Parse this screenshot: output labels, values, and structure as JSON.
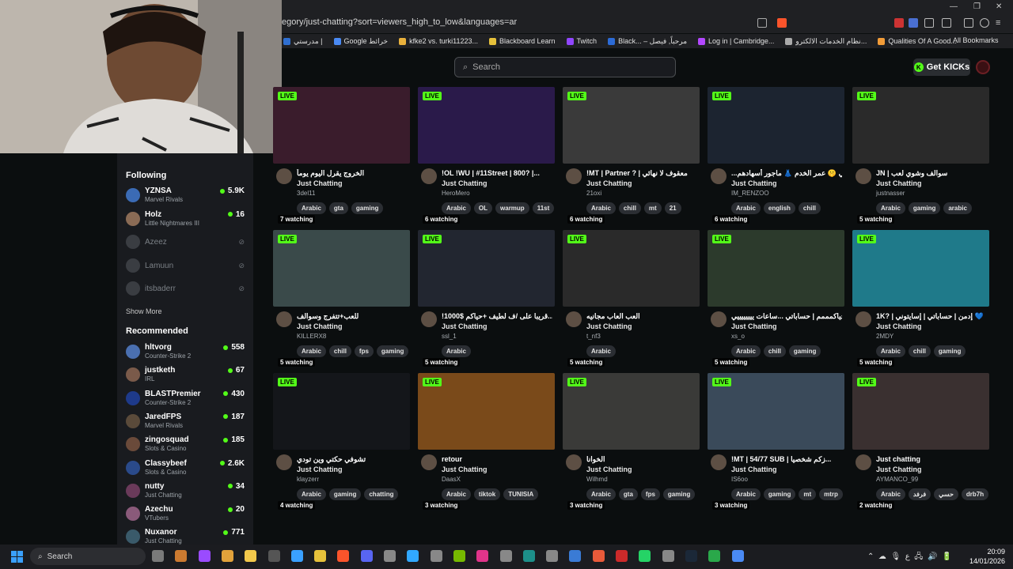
{
  "browser": {
    "url": "egory/just-chatting?sort=viewers_high_to_low&languages=ar",
    "bookmarks": [
      "مدرستي |",
      "Google خرائط",
      "kfke2 vs. turki11223...",
      "Blackboard Learn",
      "Twitch",
      "Black... – مرحباً, فيصل",
      "Log in | Cambridge...",
      "نظام الخدمات الالكترو...",
      "Qualities Of A Good..."
    ],
    "all_bookmarks": "All Bookmarks",
    "bookmark_colors": [
      "#2f6fd1",
      "#4a8af4",
      "#e9b13c",
      "#e6c13b",
      "#9146ff",
      "#2c6bd6",
      "#b347ff",
      "#aaaaaa",
      "#f29c38"
    ]
  },
  "header": {
    "search_placeholder": "Search",
    "get_kicks": "Get KICKs"
  },
  "sidebar": {
    "following_title": "Following",
    "following": [
      {
        "name": "YZNSA",
        "category": "Marvel Rivals",
        "viewers": "5.9K",
        "live": true
      },
      {
        "name": "Holz",
        "category": "Little Nightmares III",
        "viewers": "16",
        "live": true
      },
      {
        "name": "Azeez",
        "live": false
      },
      {
        "name": "Lamuun",
        "live": false
      },
      {
        "name": "itsbaderr",
        "live": false
      }
    ],
    "show_more": "Show More",
    "recommended_title": "Recommended",
    "recommended": [
      {
        "name": "hltvorg",
        "category": "Counter-Strike 2",
        "viewers": "558"
      },
      {
        "name": "justketh",
        "category": "IRL",
        "viewers": "67"
      },
      {
        "name": "BLASTPremier",
        "category": "Counter-Strike 2",
        "viewers": "430"
      },
      {
        "name": "JaredFPS",
        "category": "Marvel Rivals",
        "viewers": "187"
      },
      {
        "name": "zingosquad",
        "category": "Slots & Casino",
        "viewers": "185"
      },
      {
        "name": "Classybeef",
        "category": "Slots & Casino",
        "viewers": "2.6K"
      },
      {
        "name": "nutty",
        "category": "Just Chatting",
        "viewers": "34"
      },
      {
        "name": "Azechu",
        "category": "VTubers",
        "viewers": "20"
      },
      {
        "name": "Nuxanor",
        "category": "Just Chatting",
        "viewers": "771"
      }
    ]
  },
  "live_label": "LIVE",
  "streams": [
    {
      "watching": "7 watching",
      "title": "الخروج يقرل اليوم يوماً",
      "category": "Just Chatting",
      "channel": "3del11",
      "tags": [
        "Arabic",
        "gta",
        "gaming"
      ],
      "thumb": "#3a1c2c"
    },
    {
      "watching": "6 watching",
      "title": "!OL !WU | #11Street | 800? |...",
      "category": "Just Chatting",
      "channel": "HeroMero",
      "tags": [
        "Arabic",
        "OL",
        "warmup",
        "11st"
      ],
      "thumb": "#2a1a4a"
    },
    {
      "watching": "6 watching",
      "title": "!MT | Partner ? | معقوف لا نهائي",
      "category": "Just Chatting",
      "channel": "21oxi",
      "tags": [
        "Arabic",
        "chill",
        "mt",
        "21"
      ],
      "thumb": "#3a3a3a"
    },
    {
      "watching": "6 watching",
      "title": "...ني 🤫 عمر الخدم 👗 ماجور أسهادهم",
      "category": "Just Chatting",
      "channel": "IM_RENZOO",
      "tags": [
        "Arabic",
        "english",
        "chill"
      ],
      "thumb": "#1c2430"
    },
    {
      "watching": "5 watching",
      "title": "JN | سوالف وشوي لعب",
      "category": "Just Chatting",
      "channel": "justnasser",
      "tags": [
        "Arabic",
        "gaming",
        "arabic"
      ],
      "thumb": "#2a2a2a"
    },
    {
      "watching": "5 watching",
      "title": "للعب+تتفرج وسوالف",
      "category": "Just Chatting",
      "channel": "KILLERX8",
      "tags": [
        "Arabic",
        "chill",
        "fps",
        "gaming"
      ],
      "thumb": "#3a4a4a"
    },
    {
      "watching": "5 watching",
      "title": "!1000$ قريبا على /ف لطيف +حياكم...",
      "category": "Just Chatting",
      "channel": "ssl_1",
      "tags": [
        "Arabic"
      ],
      "thumb": "#222630"
    },
    {
      "watching": "5 watching",
      "title": "العب العاب مجانيه",
      "category": "Just Chatting",
      "channel": "t_nf3",
      "tags": [
        "Arabic"
      ],
      "thumb": "#2a2a2a"
    },
    {
      "watching": "5 watching",
      "title": "حياكمممم | حساباتي ...ساعات ييييييييي",
      "category": "Just Chatting",
      "channel": "xs_o",
      "tags": [
        "Arabic",
        "chill",
        "gaming"
      ],
      "thumb": "#2c3a2c"
    },
    {
      "watching": "5 watching",
      "title": "1K? | إدمن | حساباتي | إسايتوني 💙",
      "category": "Just Chatting",
      "channel": "2MDY",
      "tags": [
        "Arabic",
        "chill",
        "gaming"
      ],
      "thumb": "#1f7a8a"
    },
    {
      "watching": "4 watching",
      "title": "تشوفي حكتي وين تودي",
      "category": "Just Chatting",
      "channel": "klayzerr",
      "tags": [
        "Arabic",
        "gaming",
        "chatting"
      ],
      "thumb": "#14161a"
    },
    {
      "watching": "3 watching",
      "title": "retour",
      "category": "Just Chatting",
      "channel": "DaasX",
      "tags": [
        "Arabic",
        "tiktok",
        "TUNISIA"
      ],
      "thumb": "#7a4a1a"
    },
    {
      "watching": "3 watching",
      "title": "الخوانا",
      "category": "Just Chatting",
      "channel": "Wilhmd",
      "tags": [
        "Arabic",
        "gta",
        "fps",
        "gaming"
      ],
      "thumb": "#3a3a38"
    },
    {
      "watching": "3 watching",
      "title": "!MT | 54/77 SUB | زكم شخصيا...",
      "category": "Just Chatting",
      "channel": "IS6oo",
      "tags": [
        "Arabic",
        "gaming",
        "mt",
        "mtrp"
      ],
      "thumb": "#3a4a5a"
    },
    {
      "watching": "2 watching",
      "title": "Just chatting",
      "category": "Just Chatting",
      "channel": "AYMANCO_99",
      "tags": [
        "Arabic",
        "فرفد",
        "حسي",
        "drb7h"
      ],
      "thumb": "#3a3030"
    }
  ],
  "taskbar": {
    "search": "Search",
    "time": "20:09",
    "date": "14/01/2026",
    "lang": "ع"
  }
}
